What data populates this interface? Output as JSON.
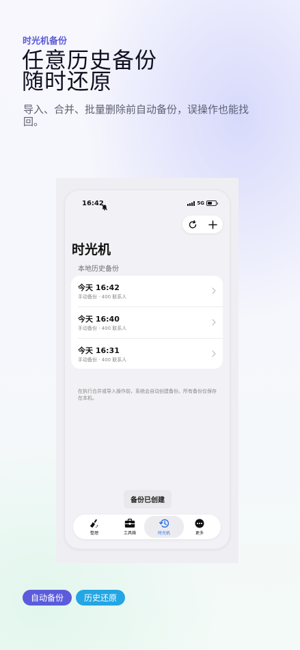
{
  "marketing": {
    "eyebrow": "时光机备份",
    "headline_line1": "任意历史备份",
    "headline_line2": "随时还原",
    "subtitle": "导入、合并、批量删除前自动备份，误操作也能找回。"
  },
  "status_bar": {
    "time": "16:42",
    "network": "5G"
  },
  "screen": {
    "title": "时光机",
    "section_title": "本地历史备份",
    "backups": [
      {
        "title": "今天 16:42",
        "meta": "手动备份 · 400 联系人"
      },
      {
        "title": "今天 16:40",
        "meta": "手动备份 · 400 联系人"
      },
      {
        "title": "今天 16:31",
        "meta": "手动备份 · 400 联系人"
      }
    ],
    "footnote": "在执行合并或导入操作前，系统会自动创建备份。所有备份仅保存在本机。",
    "toast": "备份已创建"
  },
  "tabbar": {
    "tabs": [
      {
        "label": "整理",
        "icon": "broom-icon"
      },
      {
        "label": "工具箱",
        "icon": "toolbox-icon"
      },
      {
        "label": "时光机",
        "icon": "history-icon",
        "active": true
      },
      {
        "label": "更多",
        "icon": "more-icon"
      }
    ]
  },
  "chips": [
    "自动备份",
    "历史还原"
  ],
  "colors": {
    "accent_purple": "#5b5cdc",
    "accent_blue": "#23a6e3",
    "active_tab": "#2f6fe0"
  }
}
